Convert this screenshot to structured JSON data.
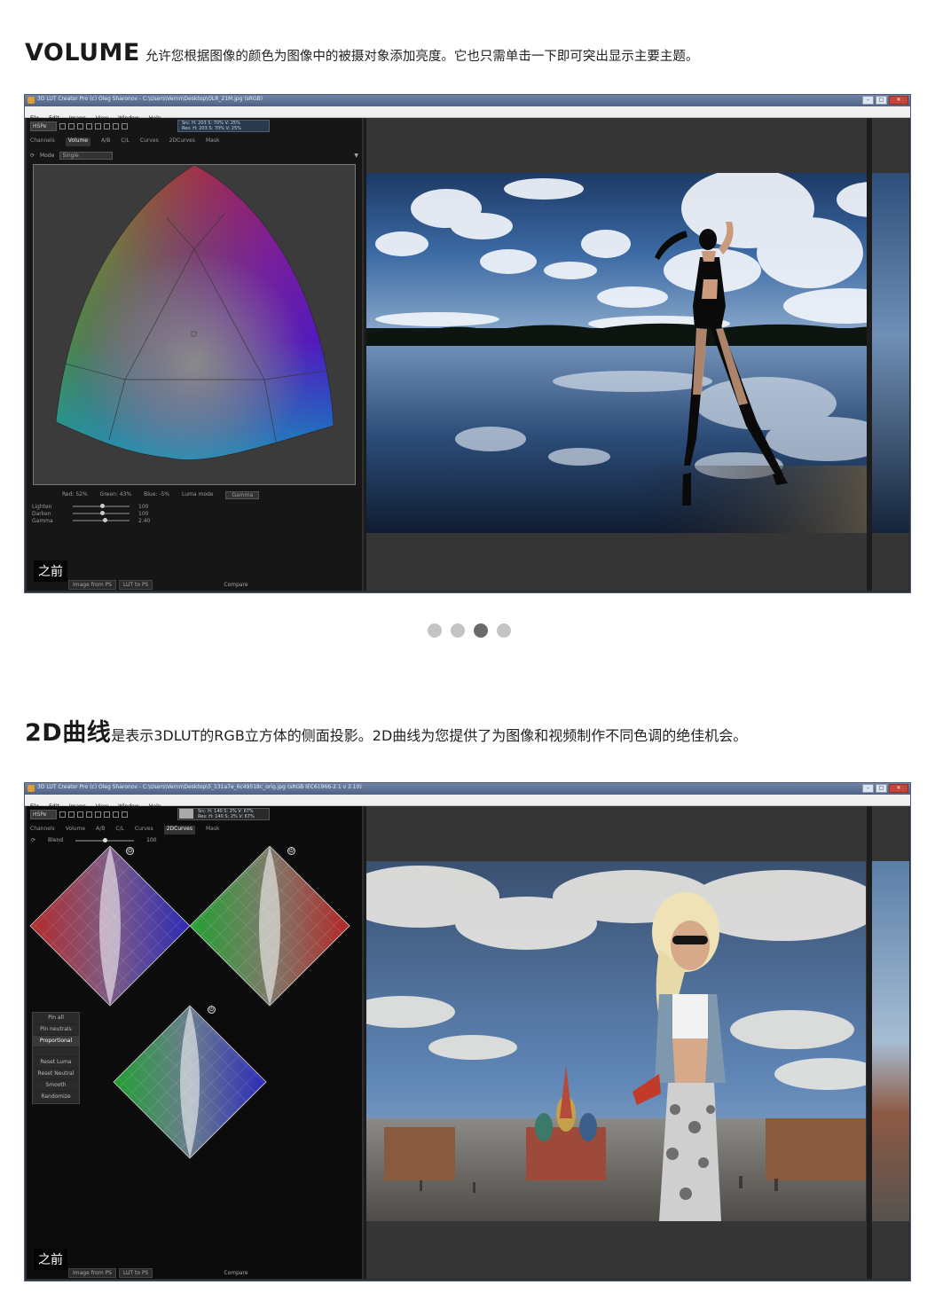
{
  "section1": {
    "keyword": "VOLUME",
    "description": "允许您根据图像的颜色为图像中的被摄对象添加亮度。它也只需单击一下即可突出显示主要主题。",
    "window": {
      "title": "3D LUT Creator Pro (c) Oleg Sharonov - C:\\Users\\Vernn\\Desktop\\OLR_21M.jpg (sRGB)",
      "menu": [
        "File",
        "Edit",
        "Image",
        "View",
        "Window",
        "Help"
      ],
      "space_select": "HSPe",
      "info_line1": "Src: H: 203  S: 70%  V: 25%",
      "info_line2": "Res: H: 203  S: 70%  V: 25%",
      "tabs": [
        "Channels",
        "Volume",
        "A/B",
        "C/L",
        "Curves",
        "2DCurves",
        "Mask"
      ],
      "active_tab": "Volume",
      "mode_label": "Mode",
      "mode_value": "Single",
      "readout": {
        "red": "Red: 52%",
        "green": "Green: 43%",
        "blue": "Blue: -5%",
        "luma_label": "Luma mode",
        "luma_value": "Gamma"
      },
      "sliders": [
        {
          "label": "Lighten",
          "value": "100",
          "level": 0.5
        },
        {
          "label": "Darken",
          "value": "100",
          "level": 0.5
        },
        {
          "label": "Gamma",
          "value": "2.40",
          "level": 0.55
        }
      ],
      "bottom_buttons": [
        "Image from PS",
        "LUT to PS"
      ],
      "compare": "Compare",
      "before_label": "之前"
    }
  },
  "carousel": {
    "count": 4,
    "active": 3
  },
  "section2": {
    "keyword": "2D曲线",
    "description": "是表示3DLUT的RGB立方体的侧面投影。2D曲线为您提供了为图像和视频制作不同色调的绝佳机会。",
    "window": {
      "title": "3D LUT Creator Pro (c) Oleg Sharonov - C:\\Users\\Vernn\\Desktop\\5_131a7e_6c49518c_orig.jpg (sRGB IEC61966-2.1 v 2.10)",
      "menu": [
        "File",
        "Edit",
        "Image",
        "View",
        "Window",
        "Help"
      ],
      "space_select": "HSPe",
      "info_line1": "Src: H: 140  S:  2%  V: 67%",
      "info_line2": "Res: H: 140  S:  2%  V: 67%",
      "tabs": [
        "Channels",
        "Volume",
        "A/B",
        "C/L",
        "Curves",
        "2DCurves",
        "Mask"
      ],
      "active_tab": "2DCurves",
      "blend_label": "Blend",
      "blend_value": "100",
      "blend_level": 0.5,
      "buttons": [
        "Pin all",
        "Pin neutrals",
        "Proportional",
        "Reset Luma",
        "Reset Neutral",
        "Smooth",
        "Randomize"
      ],
      "active_button": "Proportional",
      "bottom_buttons": [
        "Image from PS",
        "LUT to PS"
      ],
      "compare": "Compare",
      "before_label": "之前"
    }
  },
  "colors": {
    "accent_window": "#4e6286",
    "dot_active": "#6a6a6a",
    "dot_inactive": "#c4c4c4"
  }
}
